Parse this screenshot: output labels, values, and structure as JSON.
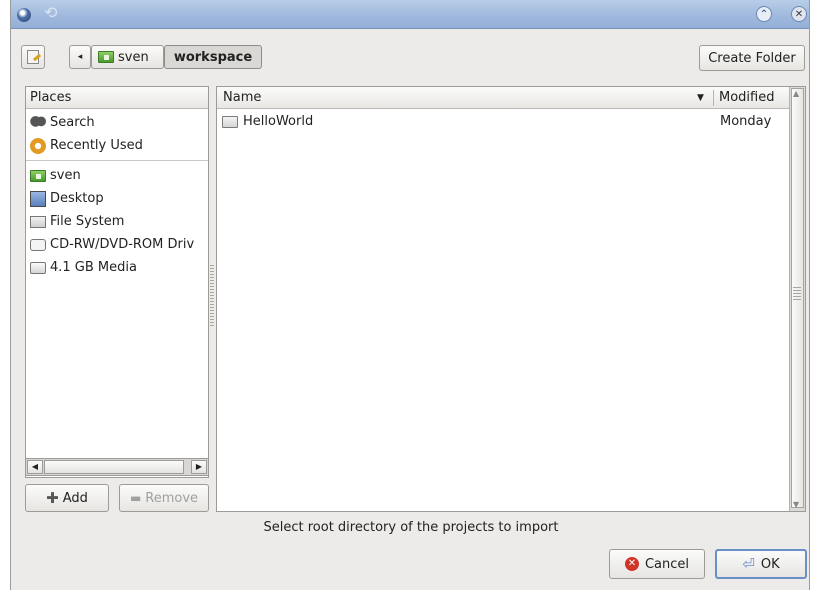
{
  "titlebar": {
    "minimize_glyph": "⌃",
    "close_glyph": "✕"
  },
  "toolbar": {
    "back_glyph": "◂",
    "path": [
      {
        "label": "sven",
        "icon": "home-folder-icon"
      },
      {
        "label": "workspace"
      }
    ],
    "create_folder_label": "Create Folder"
  },
  "places": {
    "header": "Places",
    "items": [
      {
        "label": "Search",
        "icon": "search-icon"
      },
      {
        "label": "Recently Used",
        "icon": "recent-icon"
      }
    ],
    "locations": [
      {
        "label": "sven",
        "icon": "home-folder-icon"
      },
      {
        "label": "Desktop",
        "icon": "desktop-icon"
      },
      {
        "label": "File System",
        "icon": "filesystem-icon"
      },
      {
        "label": "CD-RW/DVD-ROM Driv",
        "icon": "cdrom-icon"
      },
      {
        "label": "4.1 GB Media",
        "icon": "drive-icon"
      }
    ],
    "add_label": "Add",
    "remove_label": "Remove"
  },
  "files": {
    "columns": {
      "name": "Name",
      "modified": "Modified"
    },
    "rows": [
      {
        "name": "HelloWorld",
        "modified": "Monday",
        "icon": "folder-icon"
      }
    ]
  },
  "message": "Select root directory of the projects to import",
  "actions": {
    "cancel_label": "Cancel",
    "ok_label": "OK"
  },
  "colors": {
    "titlebar": "#9fb8dc",
    "window_bg": "#ecebe9",
    "cancel_icon": "#d0352a",
    "ok_border": "#6b8fc7"
  }
}
